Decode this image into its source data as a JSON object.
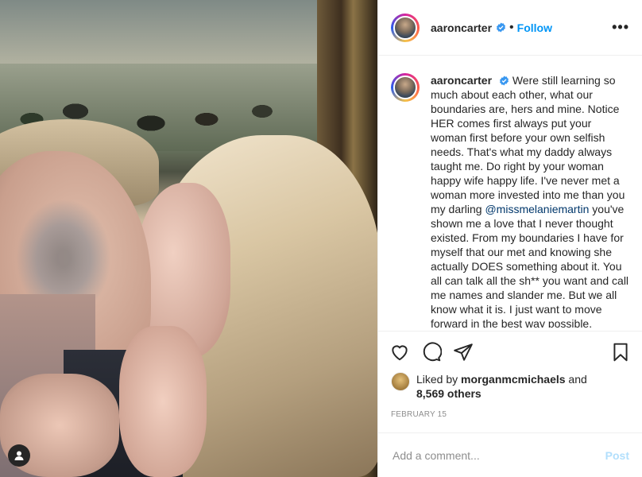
{
  "post": {
    "username": "aaroncarter",
    "follow_label": "Follow",
    "more_label": "•••",
    "dot": "•",
    "caption": {
      "username": "aaroncarter",
      "text_before_mention": "Were still learning so much about each other, what our boundaries are, hers and mine. Notice HER comes first always put your woman first before your own selfish needs. That's what my daddy always taught me. Do right by your woman happy wife happy life. I've never met a woman more invested into me than you my darling ",
      "mention": "@missmelaniemartin",
      "text_after_mention": " you've shown me a love that I never thought existed. From my boundaries I have for myself that our met and knowing she actually DOES something about it. You all can talk all the sh** you want and call me names and slander me. But we all know what it is. I just want to move forward in the best way possible. Melanie and I love the"
    },
    "likes": {
      "prefix": "Liked by ",
      "user": "morganmcmichaels",
      "and": " and",
      "others": "8,569 others"
    },
    "date": "FEBRUARY 15",
    "comment": {
      "placeholder": "Add a comment...",
      "post_label": "Post"
    },
    "icons": {
      "like": "heart-icon",
      "comment": "comment-icon",
      "share": "share-icon",
      "save": "bookmark-icon",
      "tagged_user": "user-tag-icon",
      "verified": "verified-badge-icon"
    },
    "colors": {
      "follow": "#0095f6",
      "verified": "#3897f0",
      "mention": "#00376b",
      "post_disabled": "#b2dffc"
    }
  }
}
